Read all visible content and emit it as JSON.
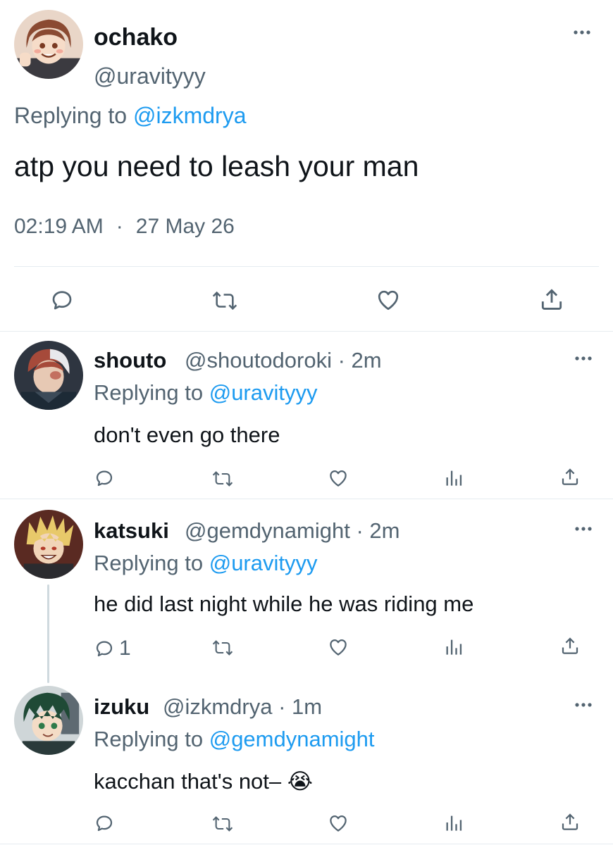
{
  "main_tweet": {
    "display_name": "ochako",
    "handle": "@uravityyy",
    "replying_prefix": "Replying to ",
    "replying_to": "@izkmdrya",
    "text": "atp you need to leash your man",
    "time": "02:19 AM",
    "separator": "·",
    "date": "27 May 26"
  },
  "replies": [
    {
      "display_name": "shouto",
      "handle": "@shoutodoroki",
      "age": "· 2m",
      "replying_prefix": "Replying to ",
      "replying_to": "@uravityyy",
      "text": "don't even go there",
      "reply_count": ""
    },
    {
      "display_name": "katsuki",
      "handle": "@gemdynamight",
      "age": "· 2m",
      "replying_prefix": "Replying to ",
      "replying_to": "@uravityyy",
      "text": "he did last night while he was riding me",
      "reply_count": "1"
    },
    {
      "display_name": "izuku",
      "handle": "@izkmdrya",
      "age": "· 1m",
      "replying_prefix": "Replying to ",
      "replying_to": "@gemdynamight",
      "text": "kacchan that's not– 😭",
      "reply_count": ""
    }
  ],
  "icons": {
    "reply": "reply-icon",
    "retweet": "retweet-icon",
    "like": "heart-icon",
    "analytics": "analytics-icon",
    "share": "share-icon",
    "more": "more-icon"
  },
  "colors": {
    "accent": "#1d9bf0",
    "secondary_text": "#536471",
    "primary_text": "#0f1419",
    "divider": "#e6ecf0"
  }
}
